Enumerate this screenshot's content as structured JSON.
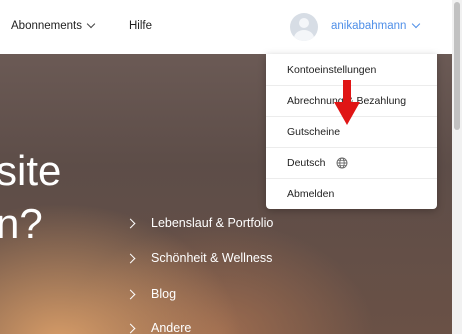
{
  "nav": {
    "subscriptions_label": "Abonnements",
    "help_label": "Hilfe",
    "username": "anikabahmann"
  },
  "hero": {
    "line1": "site",
    "line2": "n?",
    "categories": [
      "Lebenslauf & Portfolio",
      "Schönheit & Wellness",
      "Blog",
      "Andere"
    ]
  },
  "user_menu": {
    "items": [
      "Kontoeinstellungen",
      "Abrechnung & Bezahlung",
      "Gutscheine",
      "Deutsch",
      "Abmelden"
    ]
  },
  "icons": {
    "avatar": "user-avatar-icon",
    "language": "globe-icon",
    "annotation": "red-arrow-down-icon"
  },
  "colors": {
    "accent": "#4f8fe8",
    "annotation": "#e01515"
  }
}
